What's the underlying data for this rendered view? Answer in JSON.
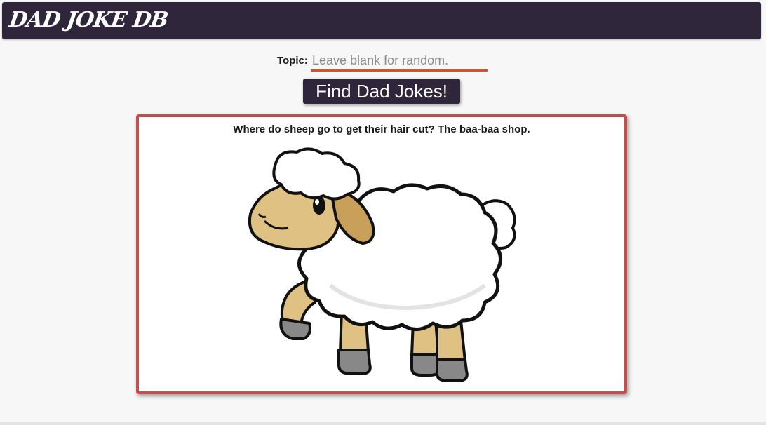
{
  "header": {
    "brand": "DAD JOKE DB"
  },
  "search": {
    "label": "Topic:",
    "value": "",
    "placeholder": "Leave blank for random."
  },
  "actions": {
    "find_label": "Find Dad Jokes!"
  },
  "result": {
    "joke": "Where do sheep go to get their hair cut? The baa-baa shop.",
    "image_subject": "cartoon-sheep-illustration"
  },
  "colors": {
    "brand_dark": "#30263c",
    "accent_underline": "#d9502d",
    "card_border": "#c44d4d"
  }
}
